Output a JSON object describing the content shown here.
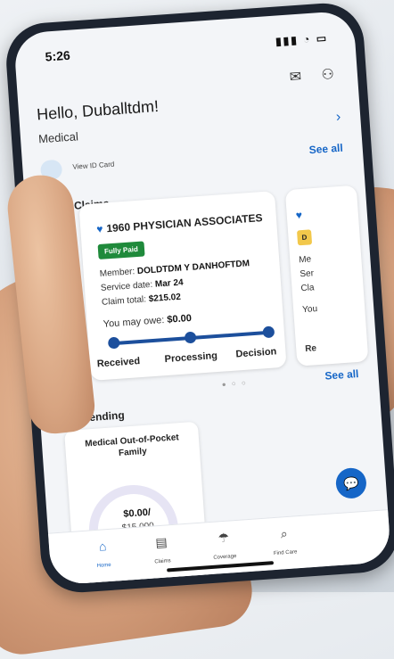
{
  "status_bar": {
    "time": "5:26"
  },
  "header": {
    "greeting": "Hello, Duballtdm!"
  },
  "plan": {
    "label": "Medical",
    "id_card_label": "View ID Card",
    "see_all": "See all"
  },
  "recent_claims": {
    "title": "ecent Claims",
    "card": {
      "provider": "1960 PHYSICIAN ASSOCIATES",
      "status": "Fully Paid",
      "member_label": "Member:",
      "member": "DOLDTDM Y DANHOFTDM",
      "service_label": "Service date:",
      "service_date": "Mar 24",
      "total_label": "Claim total:",
      "total": "$215.02",
      "owe_label": "You may owe:",
      "owe": "$0.00",
      "steps": [
        "Received",
        "Processing",
        "Decision"
      ]
    },
    "next_card": {
      "badge": "D",
      "lines": [
        "Me",
        "Ser",
        "Cla",
        "You",
        "Re"
      ]
    },
    "pager": "● ○ ○",
    "see_all": "See all"
  },
  "spending": {
    "title": "My Spending",
    "card_title": "Medical Out-of-Pocket Family",
    "spent": "$0.00/",
    "max": "$15,000",
    "progress_fraction": 0.0
  },
  "tabs": [
    {
      "label": "Home",
      "icon": "home-icon",
      "active": true
    },
    {
      "label": "Claims",
      "icon": "clipboard-icon",
      "active": false
    },
    {
      "label": "Coverage",
      "icon": "umbrella-icon",
      "active": false
    },
    {
      "label": "Find Care",
      "icon": "search-icon",
      "active": false
    }
  ],
  "colors": {
    "accent": "#1666c7",
    "paid_badge": "#1f8a3b",
    "track": "#1c4f9c"
  }
}
